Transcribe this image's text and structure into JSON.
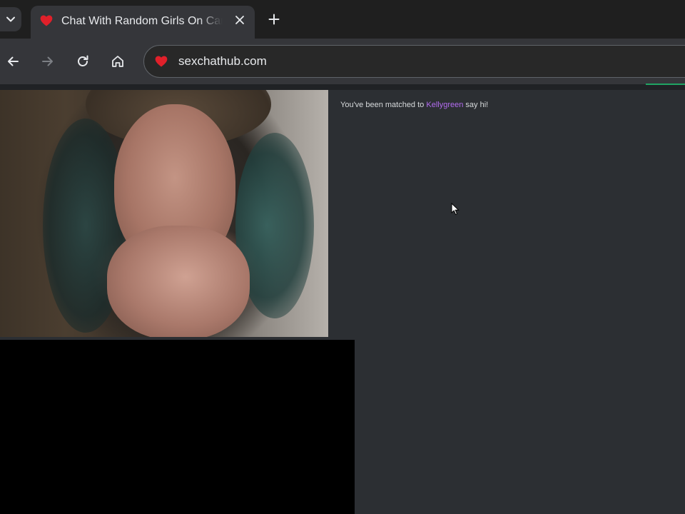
{
  "browser": {
    "tab": {
      "title": "Chat With Random Girls On Cam",
      "favicon": "heart-icon"
    },
    "toolbar": {
      "back_icon": "arrow-left-icon",
      "forward_icon": "arrow-right-icon",
      "reload_icon": "reload-icon",
      "home_icon": "home-icon"
    },
    "address_bar": {
      "url": "sexchathub.com",
      "site_icon": "heart-icon"
    },
    "colors": {
      "tabstrip_bg": "#1f1f1f",
      "toolbar_bg": "#35363a",
      "favicon_red": "#e0202a"
    }
  },
  "chat": {
    "message_prefix": "You've been matched to",
    "matched_user": "Kellygreen",
    "message_suffix": "say hi!",
    "colors": {
      "panel_bg": "#2c2f33",
      "username": "#b36cf0",
      "text": "#d7dadc"
    }
  }
}
